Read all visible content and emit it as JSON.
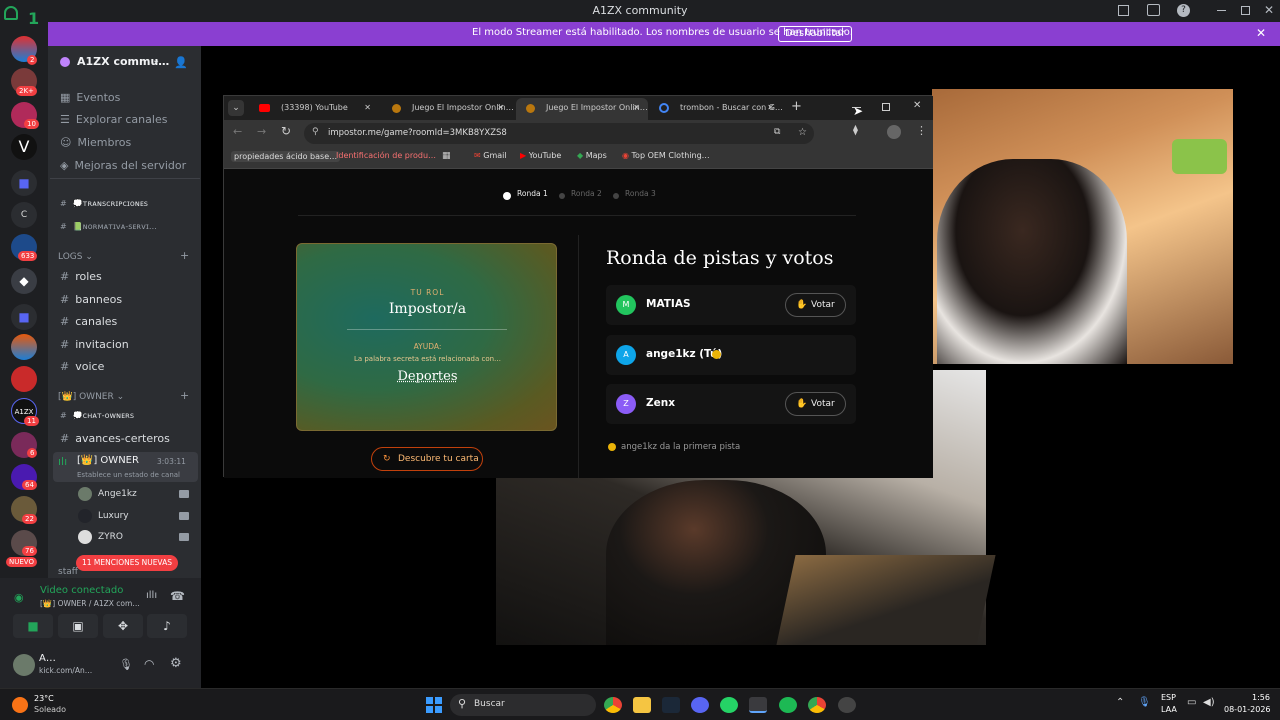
{
  "window": {
    "title": "A1ZX community"
  },
  "streamer_banner": {
    "message": "El modo Streamer está habilitado. Los nombres de usuario se han truncado.",
    "button": "Deshabilitar"
  },
  "rail": {
    "corner_count": "1",
    "badges": [
      "2",
      "2K+",
      "10",
      "633",
      "11",
      "6",
      "64",
      "22",
      "76"
    ],
    "new_label": "NUEVO"
  },
  "server": {
    "name": "A1ZX commu…",
    "menu": [
      "Eventos",
      "Explorar canales",
      "Miembros",
      "Mejoras del servidor"
    ],
    "channels_top": [
      "💭ᴛʀᴀɴsᴄʀɪᴘᴄɪᴏɴᴇs",
      "📗ɴᴏʀᴍᴀᴛɪᴠᴀ-sᴇʀᴠɪ…"
    ],
    "category_logs": "LOGS",
    "logs_channels": [
      "roles",
      "banneos",
      "canales",
      "invitacion",
      "voice"
    ],
    "category_owner": "[👑] OWNER",
    "owner_channels": [
      "💭ᴄʜᴀᴛ-ᴏᴡɴᴇʀs",
      "avances-certeros"
    ],
    "voice_channel": {
      "name": "[👑] OWNER",
      "timer": "3:03:11",
      "status": "Establece un estado de canal"
    },
    "voice_users": [
      "Ange1kz",
      "Luxury",
      "ZYRO"
    ],
    "mentions_pill": "11 MENCIONES NUEVAS",
    "category_staff": "staff"
  },
  "voice_panel": {
    "status": "Video conectado",
    "channel": "[👑] OWNER / A1ZX com…"
  },
  "user_panel": {
    "name": "A…",
    "status": "kick.com/An…"
  },
  "browser": {
    "tabs": [
      {
        "label": "(33398) YouTube",
        "icon": "youtube-icon"
      },
      {
        "label": "Juego El Impostor Onlin…",
        "icon": "game-icon"
      },
      {
        "label": "Juego El Impostor Onlin…",
        "icon": "game-icon"
      },
      {
        "label": "trombon - Buscar con G…",
        "icon": "google-icon"
      }
    ],
    "url": "impostor.me/game?roomId=3MKB8YXZS8",
    "bookmarks": [
      "propiedades ácido base…",
      "Identificación de produ…",
      "Gmail",
      "YouTube",
      "Maps",
      "Top OEM Clothing…"
    ]
  },
  "game": {
    "rounds": [
      "Ronda 1",
      "Ronda 2",
      "Ronda 3"
    ],
    "role_label": "TU ROL",
    "role": "Impostor/a",
    "help_label": "AYUDA:",
    "help_text": "La palabra secreta está relacionada con…",
    "help_word": "Deportes",
    "reveal_button": "Descubre tu carta",
    "heading": "Ronda de pistas y votos",
    "players": [
      {
        "initial": "M",
        "name": "MATIAS",
        "color": "#22c55e",
        "vote": "Votar"
      },
      {
        "initial": "A",
        "name": "ange1kz (Tú)",
        "color": "#0ea5e9",
        "vote": ""
      },
      {
        "initial": "Z",
        "name": "Zenx",
        "color": "#8b5cf6",
        "vote": "Votar"
      }
    ],
    "turn_note": "ange1kz da la primera pista"
  },
  "taskbar": {
    "weather_temp": "23°C",
    "weather_desc": "Soleado",
    "search": "Buscar",
    "lang_top": "ESP",
    "lang_bottom": "LAA",
    "time": "1:56",
    "date": "08-01-2026"
  }
}
